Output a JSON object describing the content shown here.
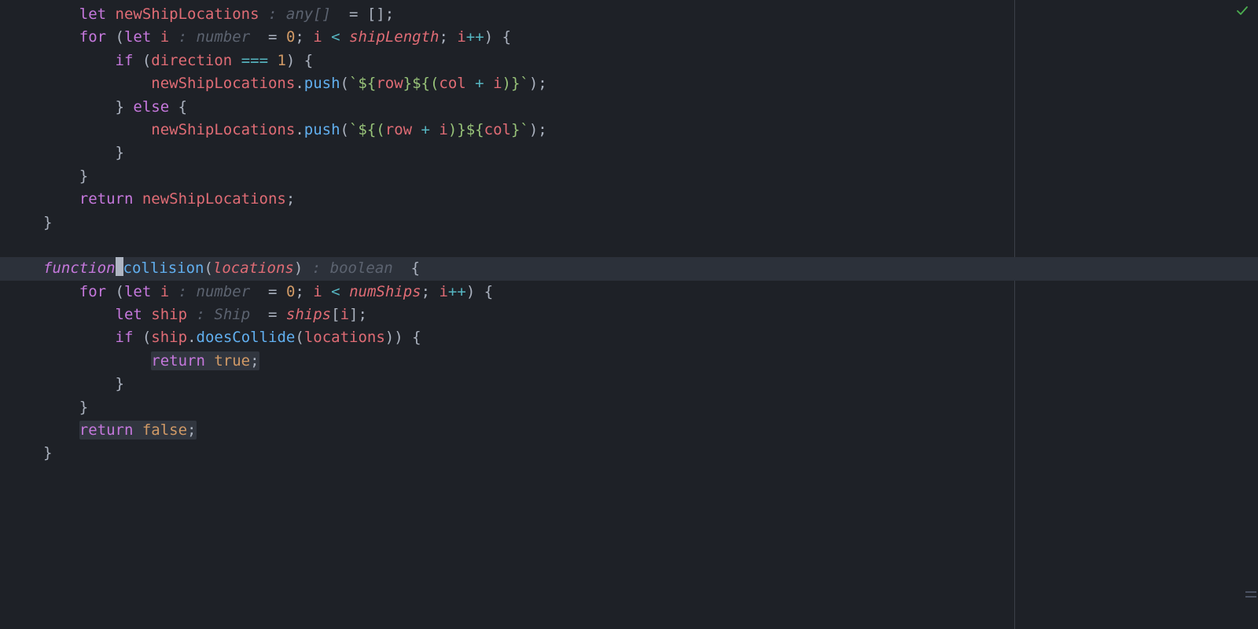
{
  "colors": {
    "background": "#1e2127",
    "current_line": "#2c313a",
    "keyword": "#c678dd",
    "variable": "#e06c75",
    "function": "#61afef",
    "number": "#d19a66",
    "string": "#98c379",
    "operator": "#56b6c2",
    "punctuation": "#abb2bf",
    "hint": "#5c6370"
  },
  "status": {
    "ok": true
  },
  "lines": {
    "l1": {
      "t": [
        "let ",
        "newShipLocations",
        " : ",
        "any[]",
        "  = [];"
      ]
    },
    "l2": {
      "t": [
        "for",
        " (",
        "let ",
        "i",
        " : ",
        "number",
        "  = ",
        "0",
        "; ",
        "i",
        " < ",
        "shipLength",
        "; ",
        "i",
        "++",
        ") {"
      ]
    },
    "l3": {
      "t": [
        "if",
        " (",
        "direction",
        " === ",
        "1",
        ") {"
      ]
    },
    "l4": {
      "t": [
        "newShipLocations",
        ".",
        "push",
        "(",
        "`${",
        "row",
        "}${(",
        "col",
        " + ",
        "i",
        ")}`",
        ");"
      ]
    },
    "l5": {
      "t": [
        "} ",
        "else",
        " {"
      ]
    },
    "l6": {
      "t": [
        "newShipLocations",
        ".",
        "push",
        "(",
        "`${(",
        "row",
        " + ",
        "i",
        ")}${",
        "col",
        "}`",
        ");"
      ]
    },
    "l7": {
      "t": [
        "}"
      ]
    },
    "l8": {
      "t": [
        "}"
      ]
    },
    "l9": {
      "t": [
        "return ",
        "newShipLocations",
        ";"
      ]
    },
    "l10": {
      "t": [
        "}"
      ]
    },
    "l11": {
      "t": [
        ""
      ]
    },
    "l12": {
      "t": [
        "function",
        " ",
        "collision",
        "(",
        "locations",
        ")",
        " : ",
        "boolean",
        "  {"
      ]
    },
    "l13": {
      "t": [
        "for",
        " (",
        "let ",
        "i",
        " : ",
        "number",
        "  = ",
        "0",
        "; ",
        "i",
        " < ",
        "numShips",
        "; ",
        "i",
        "++",
        ") {"
      ]
    },
    "l14": {
      "t": [
        "let ",
        "ship",
        " : ",
        "Ship",
        "  = ",
        "ships",
        "[",
        "i",
        "];"
      ]
    },
    "l15": {
      "t": [
        "if",
        " (",
        "ship",
        ".",
        "doesCollide",
        "(",
        "locations",
        ")) {"
      ]
    },
    "l16": {
      "t": [
        "return ",
        "true",
        ";"
      ]
    },
    "l17": {
      "t": [
        "}"
      ]
    },
    "l18": {
      "t": [
        "}"
      ]
    },
    "l19": {
      "t": [
        "return ",
        "false",
        ";"
      ]
    },
    "l20": {
      "t": [
        "}"
      ]
    }
  }
}
